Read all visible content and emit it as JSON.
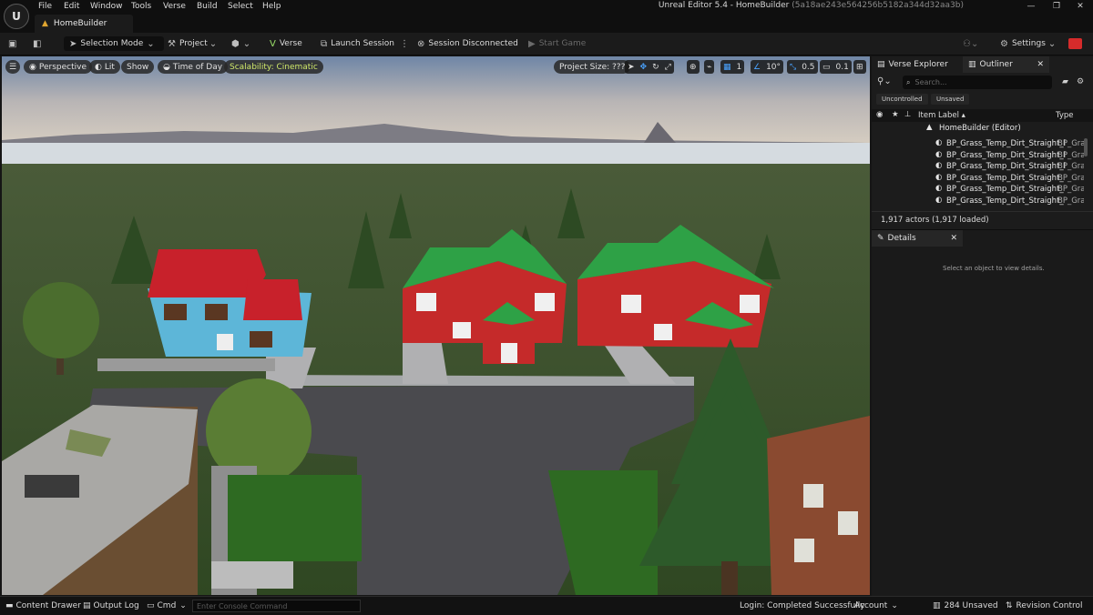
{
  "app": {
    "window_title": "Unreal Editor 5.4 - HomeBuilder",
    "window_hash": "(5a18ae243e564256b5182a344d32aa3b)",
    "project_tab": "HomeBuilder",
    "menu": [
      "File",
      "Edit",
      "Window",
      "Tools",
      "Verse",
      "Build",
      "Select",
      "Help"
    ],
    "brand_color": "#e53935"
  },
  "toolbar": {
    "selection_mode": "Selection Mode",
    "project": "Project",
    "verse": "Verse",
    "launch_session": "Launch Session",
    "session_status": "Session Disconnected",
    "start_game": "Start Game",
    "settings": "Settings"
  },
  "viewport": {
    "perspective": "Perspective",
    "lit": "Lit",
    "show": "Show",
    "time_of_day": "Time of Day",
    "scalability": "Scalability: Cinematic",
    "project_size": "Project Size: ???",
    "grid_snap": "1",
    "rotation_snap": "10°",
    "scale_snap": "0.5",
    "camera_speed": "0.1"
  },
  "verse_explorer": {
    "tab": "Verse Explorer"
  },
  "outliner": {
    "tab": "Outliner",
    "search_placeholder": "Search...",
    "filter_uncontrolled": "Uncontrolled",
    "filter_unsaved": "Unsaved",
    "col_label": "Item Label ▴",
    "col_type": "Type",
    "root": "HomeBuilder (Editor)",
    "rows": [
      {
        "label": "BP_Grass_Temp_Dirt_Straight_l",
        "type": "BP_Gra"
      },
      {
        "label": "BP_Grass_Temp_Dirt_Straight_l",
        "type": "BP_Gra"
      },
      {
        "label": "BP_Grass_Temp_Dirt_Straight_l",
        "type": "BP_Gra"
      },
      {
        "label": "BP_Grass_Temp_Dirt_Straight_",
        "type": "BP_Gra"
      },
      {
        "label": "BP_Grass_Temp_Dirt_Straight_",
        "type": "BP_Gra"
      },
      {
        "label": "BP_Grass_Temp_Dirt_Straight_",
        "type": "BP_Gra"
      }
    ],
    "actor_count": "1,917 actors (1,917 loaded)"
  },
  "details": {
    "tab": "Details",
    "empty_msg": "Select an object to view details."
  },
  "statusbar": {
    "content_drawer": "Content Drawer",
    "output_log": "Output Log",
    "cmd": "Cmd",
    "console_placeholder": "Enter Console Command",
    "login": "Login: Completed Successfully",
    "account": "Account",
    "unsaved": "284 Unsaved",
    "revision_control": "Revision Control"
  }
}
